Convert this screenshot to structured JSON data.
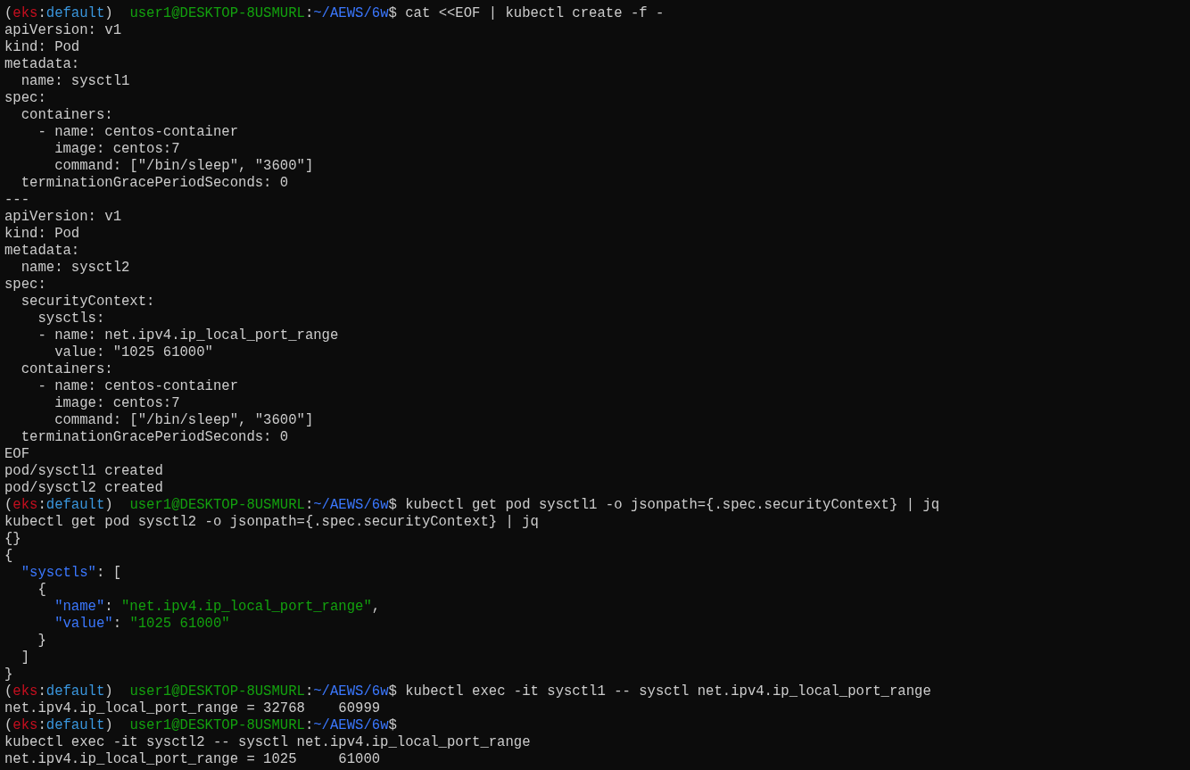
{
  "terminal": {
    "lines": [
      {
        "kind": "prompt",
        "segments": [
          {
            "kind": "plain",
            "text": "("
          },
          {
            "kind": "venv",
            "text": "eks"
          },
          {
            "kind": "plain",
            "text": ":"
          },
          {
            "kind": "context",
            "text": "default"
          },
          {
            "kind": "plain",
            "text": ")  "
          },
          {
            "kind": "user",
            "text": "user1@DESKTOP-8USMURL"
          },
          {
            "kind": "plain",
            "text": ":"
          },
          {
            "kind": "path",
            "text": "~/AEWS/6w"
          },
          {
            "kind": "plain",
            "text": "$ cat <<EOF | kubectl create -f -"
          }
        ]
      },
      {
        "kind": "output",
        "text": "apiVersion: v1"
      },
      {
        "kind": "output",
        "text": "kind: Pod"
      },
      {
        "kind": "output",
        "text": "metadata:"
      },
      {
        "kind": "output",
        "text": "  name: sysctl1"
      },
      {
        "kind": "output",
        "text": "spec:"
      },
      {
        "kind": "output",
        "text": "  containers:"
      },
      {
        "kind": "output",
        "text": "    - name: centos-container"
      },
      {
        "kind": "output",
        "text": "      image: centos:7"
      },
      {
        "kind": "output",
        "text": "      command: [\"/bin/sleep\", \"3600\"]"
      },
      {
        "kind": "output",
        "text": "  terminationGracePeriodSeconds: 0"
      },
      {
        "kind": "output",
        "text": "---"
      },
      {
        "kind": "output",
        "text": "apiVersion: v1"
      },
      {
        "kind": "output",
        "text": "kind: Pod"
      },
      {
        "kind": "output",
        "text": "metadata:"
      },
      {
        "kind": "output",
        "text": "  name: sysctl2"
      },
      {
        "kind": "output",
        "text": "spec:"
      },
      {
        "kind": "output",
        "text": "  securityContext:"
      },
      {
        "kind": "output",
        "text": "    sysctls:"
      },
      {
        "kind": "output",
        "text": "    - name: net.ipv4.ip_local_port_range"
      },
      {
        "kind": "output",
        "text": "      value: \"1025 61000\""
      },
      {
        "kind": "output",
        "text": "  containers:"
      },
      {
        "kind": "output",
        "text": "    - name: centos-container"
      },
      {
        "kind": "output",
        "text": "      image: centos:7"
      },
      {
        "kind": "output",
        "text": "      command: [\"/bin/sleep\", \"3600\"]"
      },
      {
        "kind": "output",
        "text": "  terminationGracePeriodSeconds: 0"
      },
      {
        "kind": "output",
        "text": "EOF"
      },
      {
        "kind": "output",
        "text": "pod/sysctl1 created"
      },
      {
        "kind": "output",
        "text": "pod/sysctl2 created"
      },
      {
        "kind": "prompt",
        "segments": [
          {
            "kind": "plain",
            "text": "("
          },
          {
            "kind": "venv",
            "text": "eks"
          },
          {
            "kind": "plain",
            "text": ":"
          },
          {
            "kind": "context",
            "text": "default"
          },
          {
            "kind": "plain",
            "text": ")  "
          },
          {
            "kind": "user",
            "text": "user1@DESKTOP-8USMURL"
          },
          {
            "kind": "plain",
            "text": ":"
          },
          {
            "kind": "path",
            "text": "~/AEWS/6w"
          },
          {
            "kind": "plain",
            "text": "$ kubectl get pod sysctl1 -o jsonpath={.spec.securityContext} | jq"
          }
        ]
      },
      {
        "kind": "output",
        "text": "kubectl get pod sysctl2 -o jsonpath={.spec.securityContext} | jq"
      },
      {
        "kind": "output",
        "text": "{}"
      },
      {
        "kind": "output",
        "text": "{"
      },
      {
        "kind": "json",
        "segments": [
          {
            "kind": "key",
            "text": "  \"sysctls\""
          },
          {
            "kind": "plain",
            "text": ": ["
          }
        ]
      },
      {
        "kind": "output",
        "text": "    {"
      },
      {
        "kind": "json",
        "segments": [
          {
            "kind": "key",
            "text": "      \"name\""
          },
          {
            "kind": "plain",
            "text": ": "
          },
          {
            "kind": "string",
            "text": "\"net.ipv4.ip_local_port_range\""
          },
          {
            "kind": "plain",
            "text": ","
          }
        ]
      },
      {
        "kind": "json",
        "segments": [
          {
            "kind": "key",
            "text": "      \"value\""
          },
          {
            "kind": "plain",
            "text": ": "
          },
          {
            "kind": "string",
            "text": "\"1025 61000\""
          }
        ]
      },
      {
        "kind": "output",
        "text": "    }"
      },
      {
        "kind": "output",
        "text": "  ]"
      },
      {
        "kind": "output",
        "text": "}"
      },
      {
        "kind": "prompt",
        "segments": [
          {
            "kind": "plain",
            "text": "("
          },
          {
            "kind": "venv",
            "text": "eks"
          },
          {
            "kind": "plain",
            "text": ":"
          },
          {
            "kind": "context",
            "text": "default"
          },
          {
            "kind": "plain",
            "text": ")  "
          },
          {
            "kind": "user",
            "text": "user1@DESKTOP-8USMURL"
          },
          {
            "kind": "plain",
            "text": ":"
          },
          {
            "kind": "path",
            "text": "~/AEWS/6w"
          },
          {
            "kind": "plain",
            "text": "$ kubectl exec -it sysctl1 -- sysctl net.ipv4.ip_local_port_range"
          }
        ]
      },
      {
        "kind": "output",
        "text": "net.ipv4.ip_local_port_range = 32768\t60999"
      },
      {
        "kind": "prompt",
        "segments": [
          {
            "kind": "plain",
            "text": "("
          },
          {
            "kind": "venv",
            "text": "eks"
          },
          {
            "kind": "plain",
            "text": ":"
          },
          {
            "kind": "context",
            "text": "default"
          },
          {
            "kind": "plain",
            "text": ")  "
          },
          {
            "kind": "user",
            "text": "user1@DESKTOP-8USMURL"
          },
          {
            "kind": "plain",
            "text": ":"
          },
          {
            "kind": "path",
            "text": "~/AEWS/6w"
          },
          {
            "kind": "plain",
            "text": "$"
          }
        ]
      },
      {
        "kind": "output",
        "text": "kubectl exec -it sysctl2 -- sysctl net.ipv4.ip_local_port_range"
      },
      {
        "kind": "output",
        "text": "net.ipv4.ip_local_port_range = 1025\t61000"
      }
    ]
  }
}
